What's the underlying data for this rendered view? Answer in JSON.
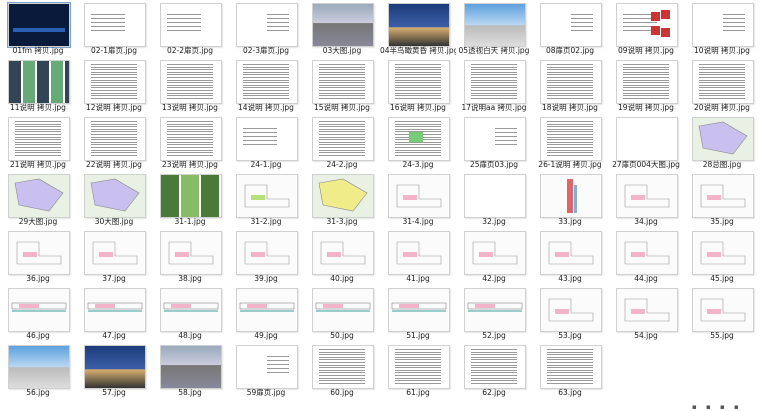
{
  "window": {
    "selected_index": 0
  },
  "files": [
    {
      "name": "01fm 拷贝.jpg",
      "kind": "dark"
    },
    {
      "name": "02-1扉页.jpg",
      "kind": "textsmall"
    },
    {
      "name": "02-2扉页.jpg",
      "kind": "textsmall"
    },
    {
      "name": "02-3扉页.jpg",
      "kind": "textright"
    },
    {
      "name": "03大图.jpg",
      "kind": "photo-building"
    },
    {
      "name": "04半鸟瞰黄昏 拷贝.jpg",
      "kind": "photo-dusk"
    },
    {
      "name": "05透视白天 拷贝.jpg",
      "kind": "photo-day"
    },
    {
      "name": "08扉页02.jpg",
      "kind": "textright"
    },
    {
      "name": "09说明 拷贝.jpg",
      "kind": "chart"
    },
    {
      "name": "10说明 拷贝.jpg",
      "kind": "textright"
    },
    {
      "name": "11说明 拷贝.jpg",
      "kind": "photos"
    },
    {
      "name": "12说明 拷贝.jpg",
      "kind": "textdense"
    },
    {
      "name": "13说明 拷贝.jpg",
      "kind": "textdense"
    },
    {
      "name": "14说明 拷贝.jpg",
      "kind": "textdense"
    },
    {
      "name": "15说明 拷贝.jpg",
      "kind": "textdense"
    },
    {
      "name": "16说明 拷贝.jpg",
      "kind": "textdense"
    },
    {
      "name": "17说明aa 拷贝.jpg",
      "kind": "textdense"
    },
    {
      "name": "18说明 拷贝.jpg",
      "kind": "textdense"
    },
    {
      "name": "19说明 拷贝.jpg",
      "kind": "textdense"
    },
    {
      "name": "20说明 拷贝.jpg",
      "kind": "textdense"
    },
    {
      "name": "21说明 拷贝.jpg",
      "kind": "textdense"
    },
    {
      "name": "22说明 拷贝.jpg",
      "kind": "textdense"
    },
    {
      "name": "23说明 拷贝.jpg",
      "kind": "textdense"
    },
    {
      "name": "24-1.jpg",
      "kind": "textsmall"
    },
    {
      "name": "24-2.jpg",
      "kind": "textdense"
    },
    {
      "name": "24-3.jpg",
      "kind": "table-green"
    },
    {
      "name": "25扉页03.jpg",
      "kind": "textright"
    },
    {
      "name": "26-1说明 拷贝.jpg",
      "kind": "table"
    },
    {
      "name": "27扉页004大图.jpg",
      "kind": "blank"
    },
    {
      "name": "28总图.jpg",
      "kind": "siteplan"
    },
    {
      "name": "29大图.jpg",
      "kind": "siteplan"
    },
    {
      "name": "30大图.jpg",
      "kind": "siteplan"
    },
    {
      "name": "31-1.jpg",
      "kind": "photos-green"
    },
    {
      "name": "31-2.jpg",
      "kind": "plan-green"
    },
    {
      "name": "31-3.jpg",
      "kind": "plan-yellow"
    },
    {
      "name": "31-4.jpg",
      "kind": "plan"
    },
    {
      "name": "32.jpg",
      "kind": "blank"
    },
    {
      "name": "33.jpg",
      "kind": "section"
    },
    {
      "name": "34.jpg",
      "kind": "plan"
    },
    {
      "name": "35.jpg",
      "kind": "plan"
    },
    {
      "name": "36.jpg",
      "kind": "plan"
    },
    {
      "name": "37.jpg",
      "kind": "plan"
    },
    {
      "name": "38.jpg",
      "kind": "plan"
    },
    {
      "name": "39.jpg",
      "kind": "plan"
    },
    {
      "name": "40.jpg",
      "kind": "plan"
    },
    {
      "name": "41.jpg",
      "kind": "plan"
    },
    {
      "name": "42.jpg",
      "kind": "plan"
    },
    {
      "name": "43.jpg",
      "kind": "plan"
    },
    {
      "name": "44.jpg",
      "kind": "plan"
    },
    {
      "name": "45.jpg",
      "kind": "plan"
    },
    {
      "name": "46.jpg",
      "kind": "longplan"
    },
    {
      "name": "47.jpg",
      "kind": "longplan"
    },
    {
      "name": "48.jpg",
      "kind": "longplan"
    },
    {
      "name": "49.jpg",
      "kind": "longplan"
    },
    {
      "name": "50.jpg",
      "kind": "longplan"
    },
    {
      "name": "51.jpg",
      "kind": "longplan"
    },
    {
      "name": "52.jpg",
      "kind": "longplan"
    },
    {
      "name": "53.jpg",
      "kind": "plan"
    },
    {
      "name": "54.jpg",
      "kind": "plan"
    },
    {
      "name": "55.jpg",
      "kind": "plan"
    },
    {
      "name": "56.jpg",
      "kind": "photo-day"
    },
    {
      "name": "57.jpg",
      "kind": "photo-dusk"
    },
    {
      "name": "58.jpg",
      "kind": "photo-building"
    },
    {
      "name": "59扉页.jpg",
      "kind": "textright"
    },
    {
      "name": "60.jpg",
      "kind": "textdense"
    },
    {
      "name": "61.jpg",
      "kind": "textdense"
    },
    {
      "name": "62.jpg",
      "kind": "table"
    },
    {
      "name": "63.jpg",
      "kind": "table"
    },
    {
      "name": "",
      "kind": "none"
    },
    {
      "name": "",
      "kind": "none"
    }
  ],
  "colors": {
    "accent": "#7da2ce",
    "selected_bg": "#cfe3fb",
    "caption": "#1a1a1a"
  }
}
